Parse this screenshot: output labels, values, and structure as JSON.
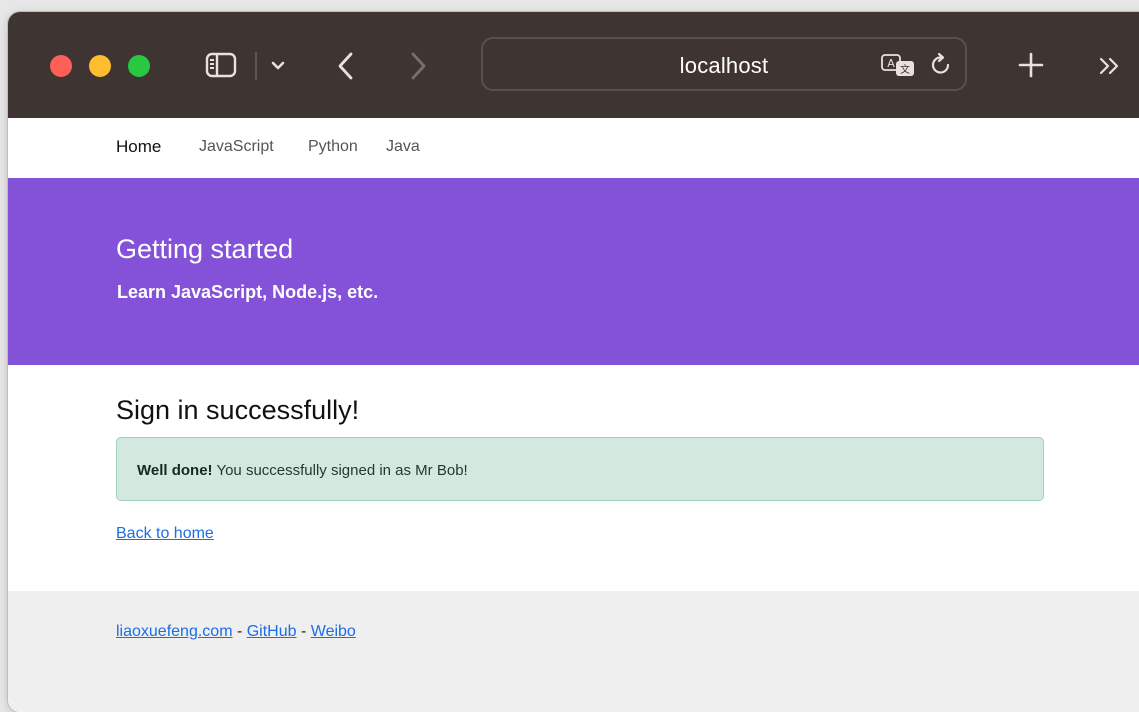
{
  "window": {
    "traffic_lights": [
      {
        "name": "close-button",
        "color": "#fe5f57"
      },
      {
        "name": "minimize-button",
        "color": "#febc2e"
      },
      {
        "name": "zoom-button",
        "color": "#28c840"
      }
    ],
    "toolbar": {
      "sidebar_icon": "sidebar-toggle-icon",
      "tab_overview_icon": "chevron-down-icon",
      "back_icon": "chevron-left-icon",
      "forward_icon": "chevron-right-icon",
      "new_tab_icon": "plus-icon",
      "more_icon": "double-chevron-right-icon"
    },
    "address_bar": {
      "url_text": "localhost",
      "translate_icon": "translate-icon",
      "reload_icon": "reload-icon"
    }
  },
  "nav": {
    "items": [
      {
        "label": "Home",
        "active": true
      },
      {
        "label": "JavaScript",
        "active": false
      },
      {
        "label": "Python",
        "active": false
      },
      {
        "label": "Java",
        "active": false
      }
    ]
  },
  "hero": {
    "title": "Getting started",
    "subtitle": "Learn JavaScript, Node.js, etc.",
    "background": "#8452d8"
  },
  "main": {
    "heading": "Sign in successfully!",
    "alert": {
      "strong": "Well done!",
      "message": " You successfully signed in as Mr Bob!"
    },
    "back_link": "Back to home"
  },
  "footer": {
    "links": [
      "liaoxuefeng.com",
      "GitHub",
      "Weibo"
    ],
    "separator": " - "
  },
  "colors": {
    "titlebar": "#3e3431",
    "link": "#1a6ee6",
    "alert_bg": "#d3e9df",
    "alert_border": "#9fd0b8",
    "footer_bg": "#efefef"
  }
}
